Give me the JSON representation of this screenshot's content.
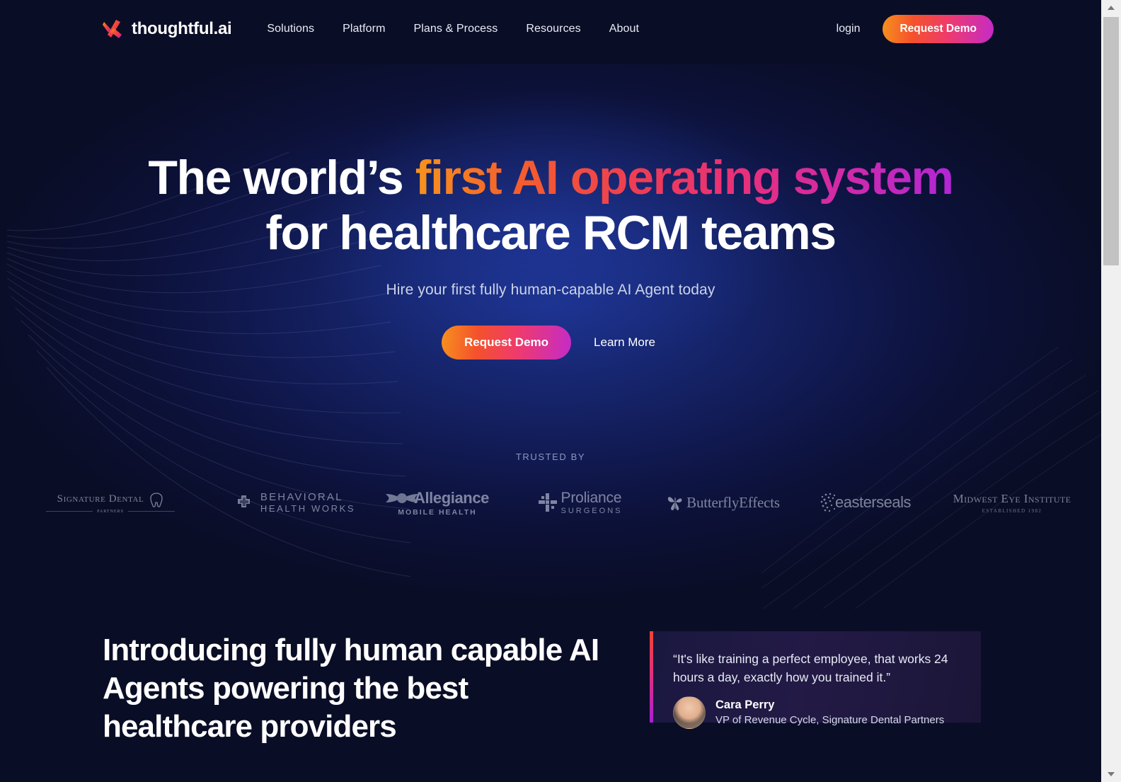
{
  "brand": {
    "name": "thoughtful.ai",
    "logo_icon": "thoughtful-x-mark-icon"
  },
  "nav": {
    "items": [
      {
        "label": "Solutions"
      },
      {
        "label": "Platform"
      },
      {
        "label": "Plans & Process"
      },
      {
        "label": "Resources"
      },
      {
        "label": "About"
      }
    ],
    "login_label": "login",
    "demo_label": "Request Demo"
  },
  "hero": {
    "headline_part1": "The world’s ",
    "headline_gradient": "first AI operating system",
    "headline_line2": "for healthcare RCM teams",
    "subtitle": "Hire your first fully human-capable AI Agent today",
    "primary_cta": "Request Demo",
    "secondary_cta": "Learn More"
  },
  "trusted": {
    "label": "TRUSTED BY",
    "logos": [
      {
        "name": "Signature Dental",
        "sub": "PARTNERS",
        "icon": "tooth-icon"
      },
      {
        "name": "BEHAVIORAL",
        "sub": "HEALTH WORKS",
        "icon": "medical-cross-icon"
      },
      {
        "name": "Allegiance",
        "sub": "MOBILE HEALTH",
        "icon": "winged-circle-icon"
      },
      {
        "name": "Proliance",
        "sub": "SURGEONS",
        "icon": "pinwheel-cross-icon"
      },
      {
        "name": "ButterflyEffects",
        "sub": "",
        "icon": "butterfly-icon"
      },
      {
        "name": "easterseals",
        "sub": "",
        "icon": "dot-burst-icon"
      },
      {
        "name": "Midwest Eye Institute",
        "sub": "ESTABLISHED 1982",
        "icon": ""
      },
      {
        "name": "",
        "sub": "",
        "icon": "partial-logo-icon"
      }
    ]
  },
  "section2": {
    "heading": "Introducing fully human capable AI Agents powering the best healthcare providers",
    "testimonial": {
      "quote": "“It's like training a perfect employee, that works 24 hours a day, exactly how you trained it.”",
      "author": "Cara Perry",
      "role": "VP of Revenue Cycle, Signature Dental Partners"
    }
  },
  "colors": {
    "background": "#0a0d26",
    "hero_glow": "#1b2f86",
    "accent_orange": "#f7931e",
    "accent_red": "#ee3e52",
    "accent_pink": "#e93079",
    "accent_purple": "#b226d6",
    "text_muted": "#8d97bd"
  },
  "scrollbar": {
    "up_icon": "scroll-up-arrow-icon",
    "down_icon": "scroll-down-arrow-icon"
  }
}
